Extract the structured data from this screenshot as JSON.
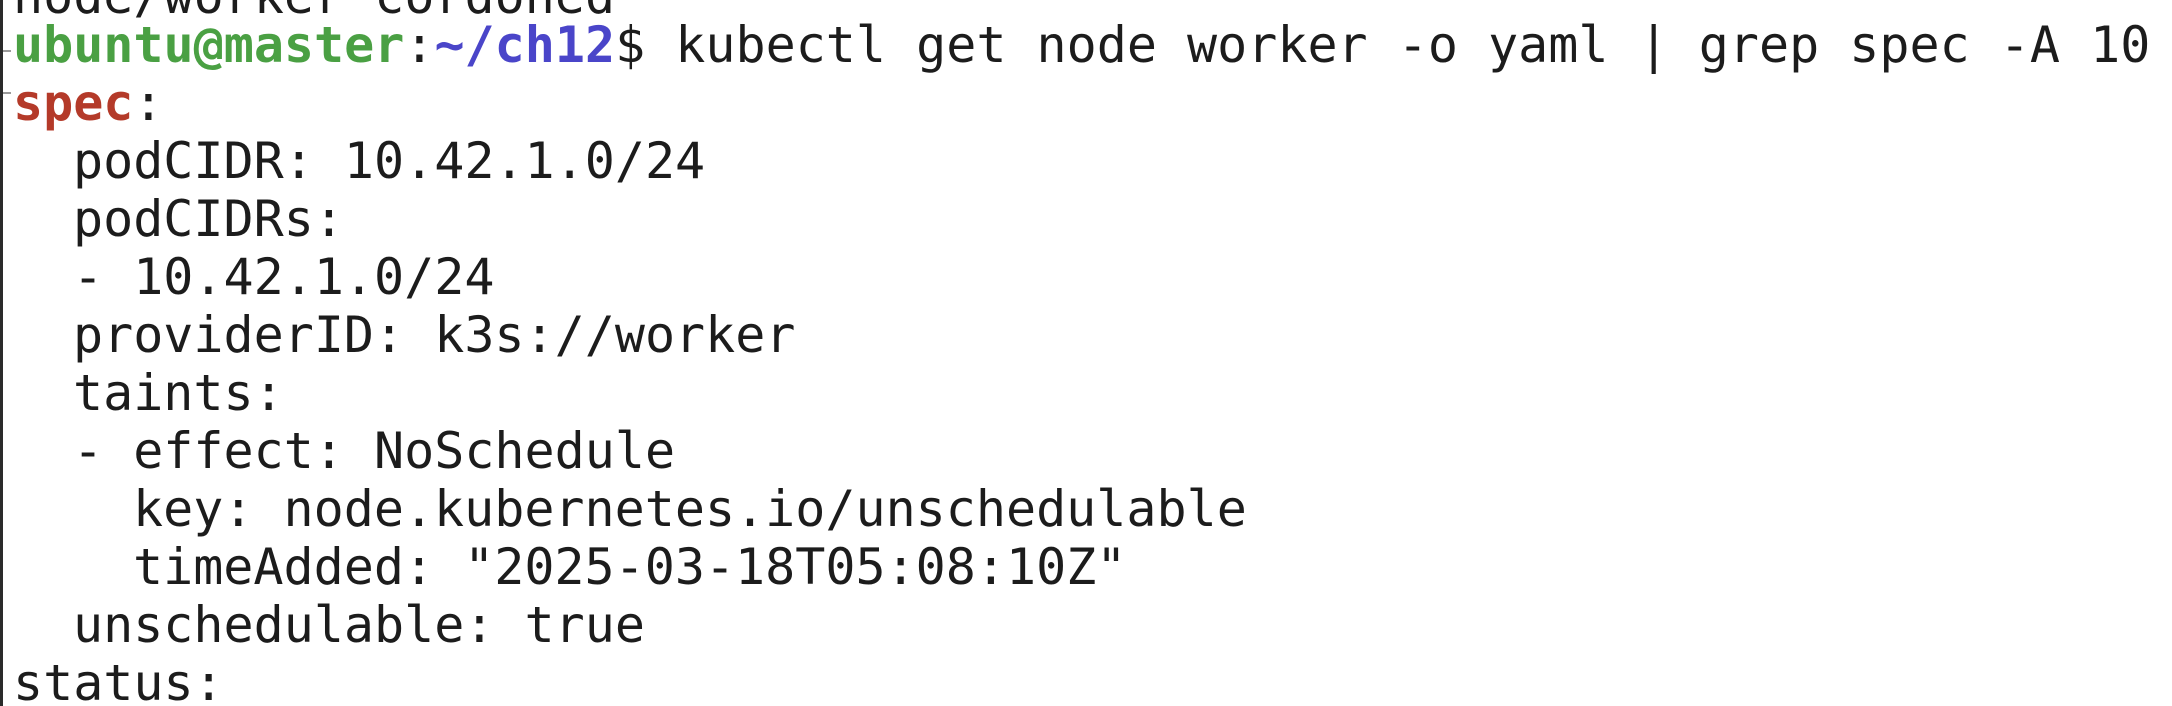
{
  "terminal": {
    "previous_output": "node/worker cordoned",
    "prompt": {
      "user_host": "ubuntu@master",
      "separator": ":",
      "cwd": "~/ch12",
      "symbol": "$ "
    },
    "command": "kubectl get node worker -o yaml | grep spec -A 10",
    "output": {
      "spec_key": "spec",
      "spec_colon": ":",
      "line_podcidr": "podCIDR: 10.42.1.0/24",
      "line_podcidrs": "podCIDRs:",
      "line_podcidrs_item": "- 10.42.1.0/24",
      "line_providerid": "providerID: k3s://worker",
      "line_taints": "taints:",
      "line_effect": "- effect: NoSchedule",
      "line_key": "key: node.kubernetes.io/unschedulable",
      "line_timeadded": "timeAdded: \"2025-03-18T05:08:10Z\"",
      "line_unschedulable": "unschedulable: true",
      "line_status": "status:"
    },
    "colors": {
      "prompt_user": "#4aa043",
      "prompt_cwd": "#4a45c9",
      "grep_match": "#b43a29",
      "text": "#1c1c1c",
      "background": "#ffffff"
    }
  }
}
